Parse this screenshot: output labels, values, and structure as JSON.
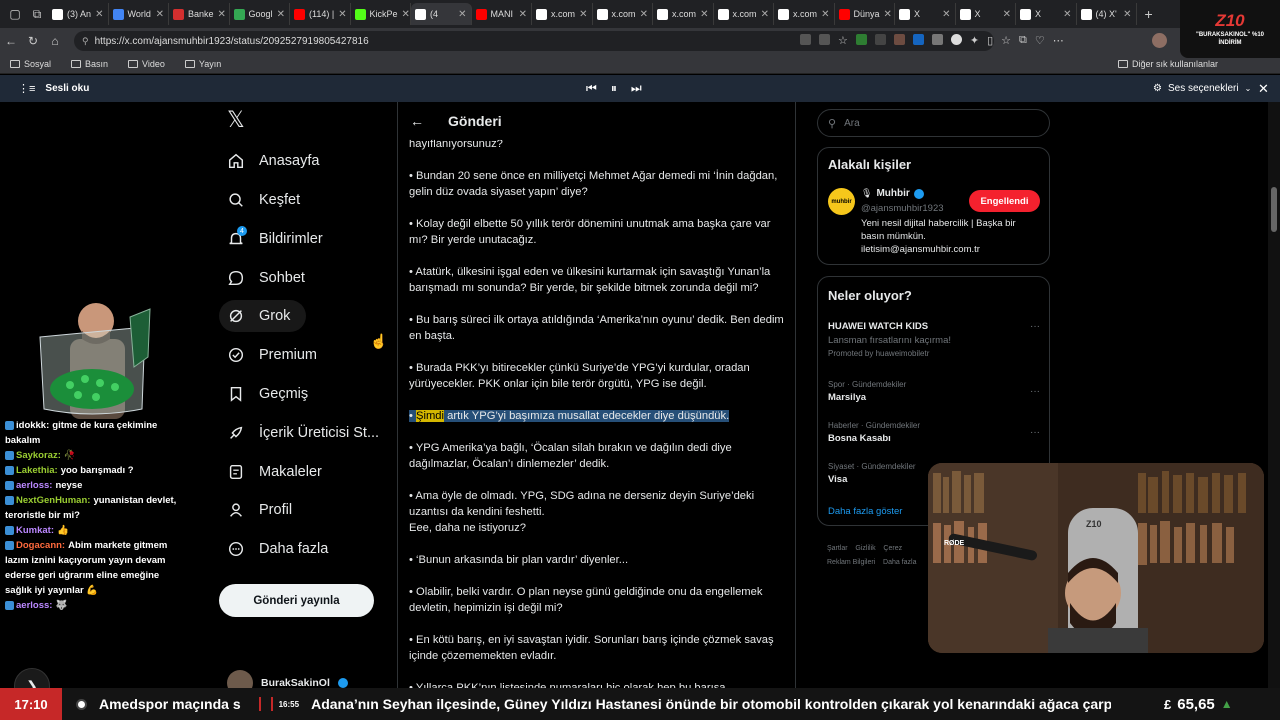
{
  "browser": {
    "tabs": [
      {
        "label": "(3) An",
        "color": "#ffffff",
        "active": false
      },
      {
        "label": "World",
        "color": "#4285f4",
        "active": false
      },
      {
        "label": "Banke",
        "color": "#d32f2f",
        "active": false
      },
      {
        "label": "Googl",
        "color": "#34a853",
        "active": false
      },
      {
        "label": "(114) |",
        "color": "#ff0000",
        "active": false
      },
      {
        "label": "KickPe",
        "color": "#53fc18",
        "active": false
      },
      {
        "label": "(4",
        "color": "#ffffff",
        "active": true
      },
      {
        "label": "MANI",
        "color": "#ff0000",
        "active": false
      },
      {
        "label": "x.com",
        "color": "#ffffff",
        "active": false
      },
      {
        "label": "x.com",
        "color": "#ffffff",
        "active": false
      },
      {
        "label": "x.com",
        "color": "#ffffff",
        "active": false
      },
      {
        "label": "x.com",
        "color": "#ffffff",
        "active": false
      },
      {
        "label": "x.com",
        "color": "#ffffff",
        "active": false
      },
      {
        "label": "Dünya",
        "color": "#ff0000",
        "active": false
      },
      {
        "label": "X",
        "color": "#ffffff",
        "active": false
      },
      {
        "label": "X",
        "color": "#ffffff",
        "active": false
      },
      {
        "label": "X",
        "color": "#ffffff",
        "active": false
      },
      {
        "label": "(4) X'",
        "color": "#ffffff",
        "active": false
      }
    ],
    "new_tab": "+",
    "url": "https://x.com/ajansmuhbir1923/status/2092527919805427816",
    "bookmarks": [
      "Sosyal",
      "Basın",
      "Video",
      "Yayın"
    ],
    "other_bookmarks": "Diğer sık kullanılanlar"
  },
  "read_aloud": {
    "label": "Sesli oku",
    "voice_options": "Ses seçenekleri"
  },
  "nav": {
    "items": [
      {
        "label": "Anasayfa",
        "icon": "home-icon"
      },
      {
        "label": "Keşfet",
        "icon": "search-icon"
      },
      {
        "label": "Bildirimler",
        "icon": "bell-icon"
      },
      {
        "label": "Sohbet",
        "icon": "chat-icon"
      },
      {
        "label": "Grok",
        "icon": "grok-icon"
      },
      {
        "label": "Premium",
        "icon": "premium-icon"
      },
      {
        "label": "Geçmiş",
        "icon": "bookmark-icon"
      },
      {
        "label": "İçerik Üreticisi St...",
        "icon": "rocket-icon"
      },
      {
        "label": "Makaleler",
        "icon": "article-icon"
      },
      {
        "label": "Profil",
        "icon": "person-icon"
      },
      {
        "label": "Daha fazla",
        "icon": "more-circle-icon"
      }
    ],
    "notification_badge": "4",
    "post_button": "Gönderi yayınla",
    "account_name": "BurakSakinOl"
  },
  "post": {
    "header": "Gönderi",
    "paragraphs": [
      "hayıflanıyorsunuz?",
      "• Bundan 20 sene önce en milliyetçi Mehmet Ağar demedi mi ‘İnin dağdan, gelin düz ovada siyaset yapın’ diye?",
      "• Kolay değil elbette 50 yıllık terör dönemini unutmak ama başka çare var mı? Bir yerde unutacağız.",
      "• Atatürk, ülkesini işgal eden ve ülkesini kurtarmak için savaştığı Yunan’la barışmadı mı sonunda? Bir yerde, bir şekilde bitmek zorunda değil mi?",
      "• Bu barış süreci ilk ortaya atıldığında ‘Amerika’nın oyunu’ dedik. Ben dedim en başta.",
      "• Burada PKK’yı bitirecekler çünkü Suriye’de YPG’yi kurdular, oradan yürüyecekler. PKK onlar için bile terör örgütü, YPG ise değil.",
      "",
      "• YPG Amerika’ya bağlı, ‘Öcalan silah bırakın ve dağılın dedi diye dağılmazlar, Öcalan’ı dinlemezler’ dedik.",
      "• Ama öyle de olmadı. YPG, SDG adına ne derseniz deyin Suriye’deki uzantısı da kendini feshetti.",
      "Eee, daha ne istiyoruz?",
      "• ‘Bunun arkasında bir plan vardır’ diyenler...",
      "• Olabilir, belki vardır. O plan neyse günü geldiğinde onu da engellemek devletin, hepimizin işi değil mi?",
      "• En kötü barış, en iyi savaştan iyidir. Sorunları barış içinde çözmek savaş içinde çözememekten evladır.",
      "• Yıllarca PKK’nın listesinde numaraları hiç olarak hep bu barışa"
    ],
    "highlight_bullet": "• ",
    "highlight_word": "Şimdi",
    "highlight_rest": " artık YPG’yi başımıza musallat edecekler diye düşündük."
  },
  "sidebar": {
    "search_placeholder": "Ara",
    "relevant_title": "Alakalı kişiler",
    "person": {
      "name": "Muhbir",
      "handle": "@ajansmuhbir1923",
      "bio": "Yeni nesil dijital habercilik | Başka bir basın mümkün. iletisim@ajansmuhbir.com.tr",
      "button": "Engellendi",
      "avatar_text": "muhbir"
    },
    "whats_happening": "Neler oluyor?",
    "trends": [
      {
        "context": "",
        "name": "HUAWEI WATCH KIDS",
        "sub": "Lansman fırsatlarını kaçırma!",
        "promo": "Promoted by huaweimobiletr"
      },
      {
        "context": "Spor · Gündemdekiler",
        "name": "Marsilya",
        "sub": "",
        "promo": ""
      },
      {
        "context": "Haberler · Gündemdekiler",
        "name": "Bosna Kasabı",
        "sub": "",
        "promo": ""
      },
      {
        "context": "Siyaset · Gündemdekiler",
        "name": "Visa",
        "sub": "",
        "promo": ""
      }
    ],
    "show_more": "Daha fazla göster",
    "footer": [
      "Şartlar",
      "Gizlilik",
      "Çerez",
      "Reklam Bilgileri",
      "Daha fazla"
    ],
    "more_dots": "···"
  },
  "stream": {
    "logo": "Z10",
    "logo_sub": "\"BURAKSAKINOL\" %10 İNDİRİM",
    "chat": [
      {
        "user": "idokkk:",
        "text": "gitme de kura çekimine bakalım",
        "color": "#ffffff"
      },
      {
        "user": "Saykoraz:",
        "text": "🥀",
        "color": "#9acd32"
      },
      {
        "user": "Lakethia:",
        "text": "yoo barışmadı ?",
        "color": "#9acd32"
      },
      {
        "user": "aerloss:",
        "text": "neyse",
        "color": "#bb88ff"
      },
      {
        "user": "NextGenHuman:",
        "text": "yunanistan devlet, teroristle bir mi?",
        "color": "#9acd32"
      },
      {
        "user": "Kumkat:",
        "text": "👍",
        "color": "#bb88ff"
      },
      {
        "user": "Dogacann:",
        "text": "Abim markete gitmem lazım iznini kaçıyorum yayın devam ederse geri uğrarım eline emeğine sağlık iyi yayınlar 💪",
        "color": "#ff6a3d"
      },
      {
        "user": "aerloss:",
        "text": "🐺",
        "color": "#bb88ff"
      }
    ],
    "cam_brand": "RØDE",
    "chair_brand": "Z10"
  },
  "ticker": {
    "time": "17:10",
    "left_text": "Amedspor maçında s",
    "news_time": "16:55",
    "news_text": "Adana’nın Seyhan ilçesinde, Güney Yıldızı Hastanesi önünde bir otomobil kontrolden çıkarak yol kenarındaki ağaca çarptı. K",
    "currency_symbol": "£",
    "currency_value": "65,65",
    "currency_arrow": "▲"
  }
}
